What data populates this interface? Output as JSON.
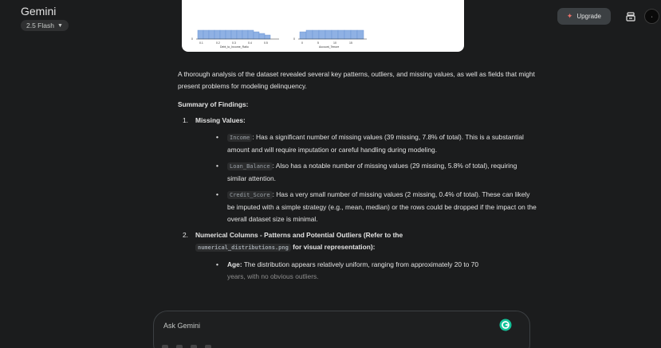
{
  "app": {
    "title": "Gemini",
    "model": "2.5 Flash"
  },
  "header": {
    "upgrade_label": "Upgrade"
  },
  "chart": {
    "left_xlabel": "Debt_to_Income_Ratio",
    "right_xlabel": "Account_Tenure",
    "left_ticks": [
      "0.1",
      "0.2",
      "0.3",
      "0.4",
      "0.5"
    ],
    "right_ticks": [
      "0",
      "5",
      "10",
      "15"
    ],
    "left_y0": "0",
    "right_y0": "0"
  },
  "response": {
    "intro": "A thorough analysis of the dataset revealed several key patterns, outliers, and missing values, as well as fields that might present problems for modeling delinquency.",
    "summary_heading": "Summary of Findings:",
    "sections": [
      {
        "marker": "1.",
        "heading": "Missing Values:",
        "bullets": [
          {
            "code": "Income",
            "text": ": Has a significant number of missing values (39 missing, 7.8% of total). This is a substantial amount and will require imputation or careful handling during modeling."
          },
          {
            "code": "Loan_Balance",
            "text": ": Also has a notable number of missing values (29 missing, 5.8% of total), requiring similar attention."
          },
          {
            "code": "Credit_Score",
            "text": ": Has a very small number of missing values (2 missing, 0.4% of total). These can likely be imputed with a simple strategy (e.g., mean, median) or the rows could be dropped if the impact on the overall dataset size is minimal."
          }
        ]
      },
      {
        "marker": "2.",
        "heading_part1": "Numerical Columns - Patterns and Potential Outliers (Refer to the",
        "heading_code": "numerical_distributions.png",
        "heading_part2": "for visual representation):",
        "bullets": [
          {
            "label": "Age:",
            "text": "The distribution appears relatively uniform, ranging from approximately 20 to 70",
            "text_faded": "years, with no obvious outliers."
          }
        ]
      }
    ]
  },
  "input": {
    "placeholder": "Ask Gemini"
  }
}
